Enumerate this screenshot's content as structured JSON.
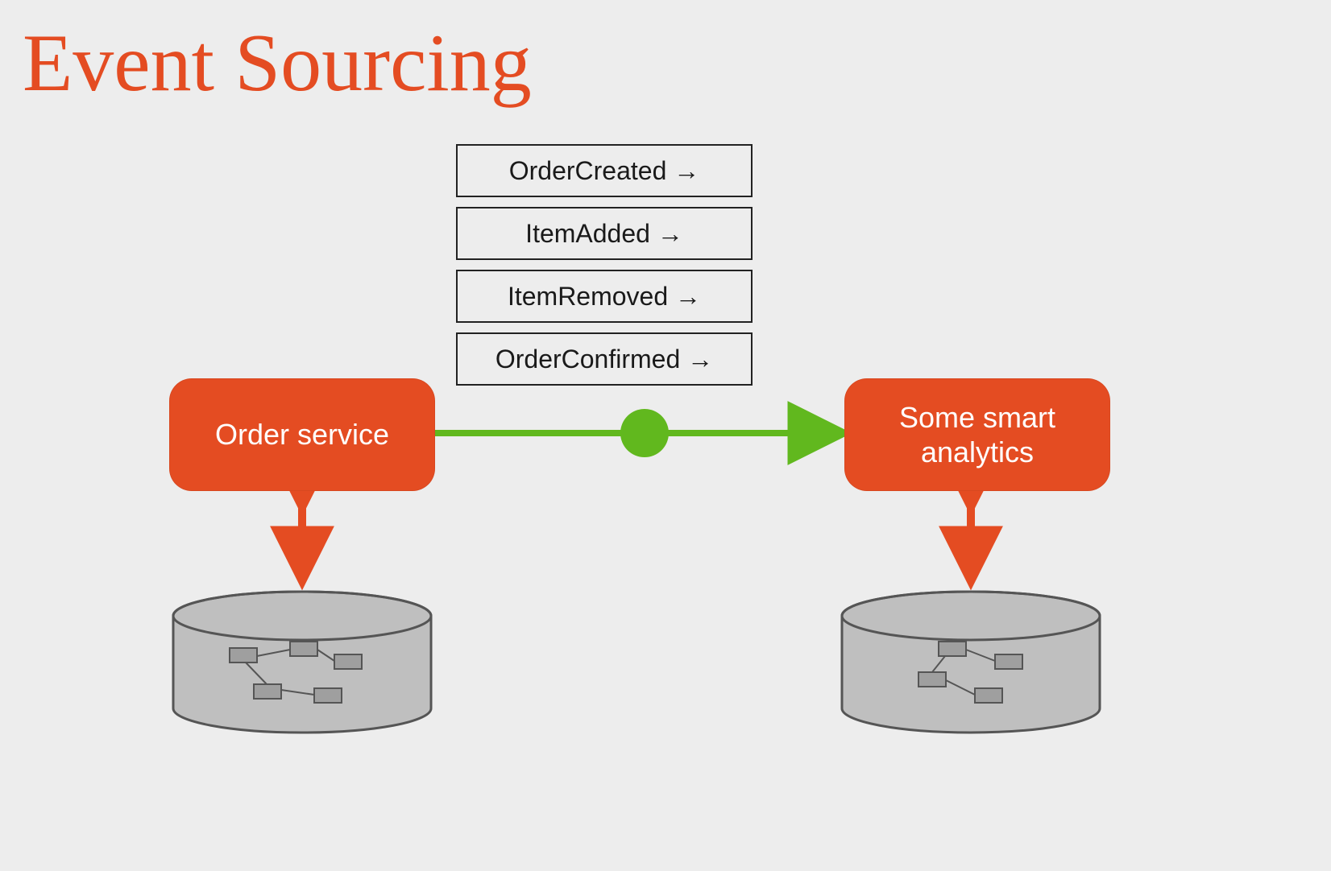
{
  "slide": {
    "title": "Event Sourcing"
  },
  "events": [
    "OrderCreated  →",
    "ItemAdded  →",
    "ItemRemoved  →",
    "OrderConfirmed  →"
  ],
  "services": {
    "left": "Order service",
    "right": "Some smart analytics"
  },
  "colors": {
    "accent": "#e44c22",
    "green": "#61b81e",
    "background": "#ededed",
    "box_border": "#222222",
    "cylinder_fill": "#bfbfbf",
    "cylinder_stroke": "#555555"
  }
}
